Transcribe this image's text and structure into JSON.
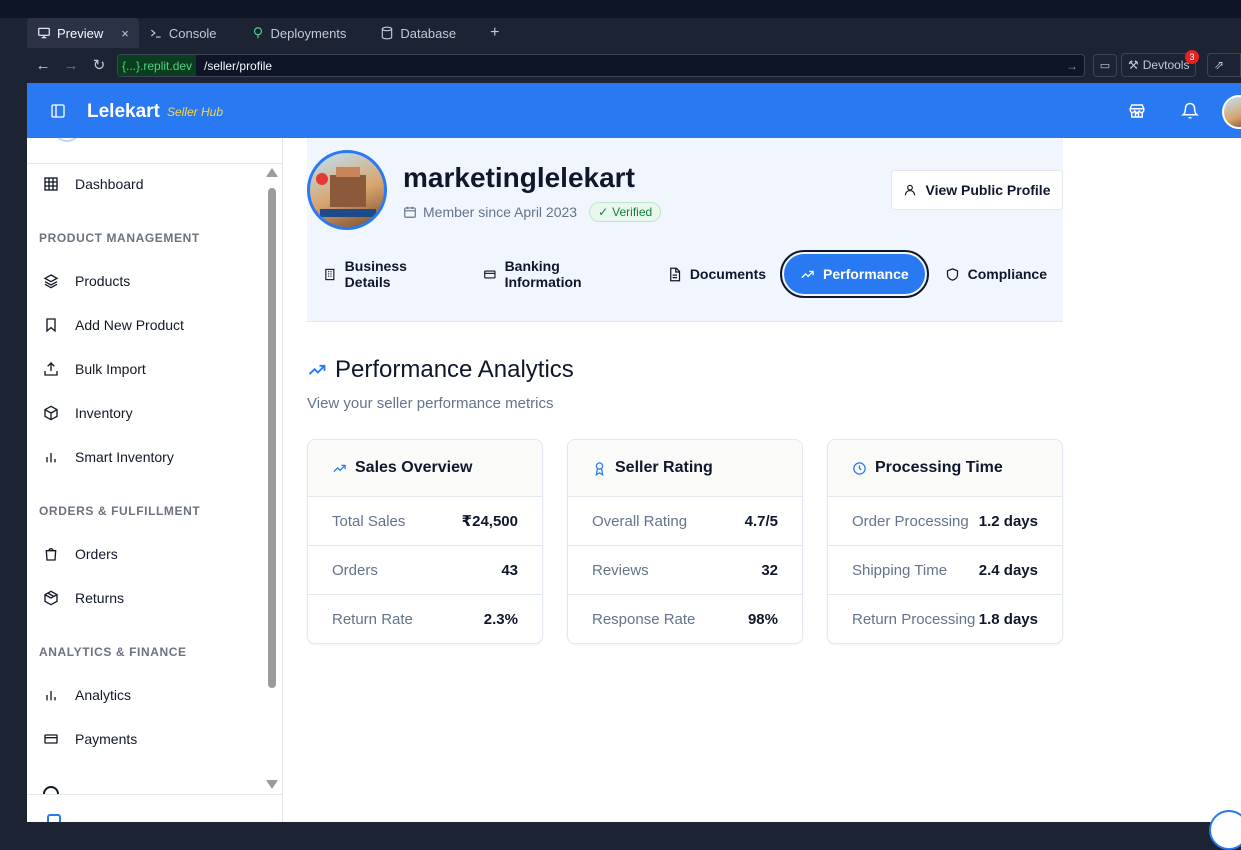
{
  "ide": {
    "tabs": [
      {
        "label": "Preview"
      },
      {
        "label": "Console"
      },
      {
        "label": "Deployments"
      },
      {
        "label": "Database"
      }
    ],
    "add_tab": "+",
    "close_tab": "×",
    "url_host": "{...}.replit.dev",
    "url_path": "/seller/profile",
    "devtools_label": "Devtools",
    "devtools_badge": "3"
  },
  "header": {
    "brand": "Lelekart",
    "brand_sub": "Seller Hub"
  },
  "sidebar": {
    "dashboard": "Dashboard",
    "section1": "PRODUCT MANAGEMENT",
    "products": "Products",
    "add_product": "Add New Product",
    "bulk_import": "Bulk Import",
    "inventory": "Inventory",
    "smart_inventory": "Smart Inventory",
    "section2": "ORDERS & FULFILLMENT",
    "orders": "Orders",
    "returns": "Returns",
    "section3": "ANALYTICS & FINANCE",
    "analytics": "Analytics",
    "payments": "Payments"
  },
  "profile": {
    "username": "marketinglelekart",
    "member_since": "Member since April 2023",
    "verified": "Verified",
    "view_public": "View Public Profile",
    "tabs": {
      "business": "Business Details",
      "banking": "Banking Information",
      "documents": "Documents",
      "performance": "Performance",
      "compliance": "Compliance"
    }
  },
  "analytics": {
    "title": "Performance Analytics",
    "subtitle": "View your seller performance metrics",
    "cards": [
      {
        "title": "Sales Overview",
        "rows": [
          {
            "k": "Total Sales",
            "v": "₹24,500"
          },
          {
            "k": "Orders",
            "v": "43"
          },
          {
            "k": "Return Rate",
            "v": "2.3%"
          }
        ]
      },
      {
        "title": "Seller Rating",
        "rows": [
          {
            "k": "Overall Rating",
            "v": "4.7/5"
          },
          {
            "k": "Reviews",
            "v": "32"
          },
          {
            "k": "Response Rate",
            "v": "98%"
          }
        ]
      },
      {
        "title": "Processing Time",
        "rows": [
          {
            "k": "Order Processing",
            "v": "1.2 days"
          },
          {
            "k": "Shipping Time",
            "v": "2.4 days"
          },
          {
            "k": "Return Processing",
            "v": "1.8 days"
          }
        ]
      }
    ]
  },
  "colors": {
    "brand_blue": "#2979f2",
    "brand_sub_yellow": "#ffd54a",
    "verified_green": "#15803d"
  }
}
